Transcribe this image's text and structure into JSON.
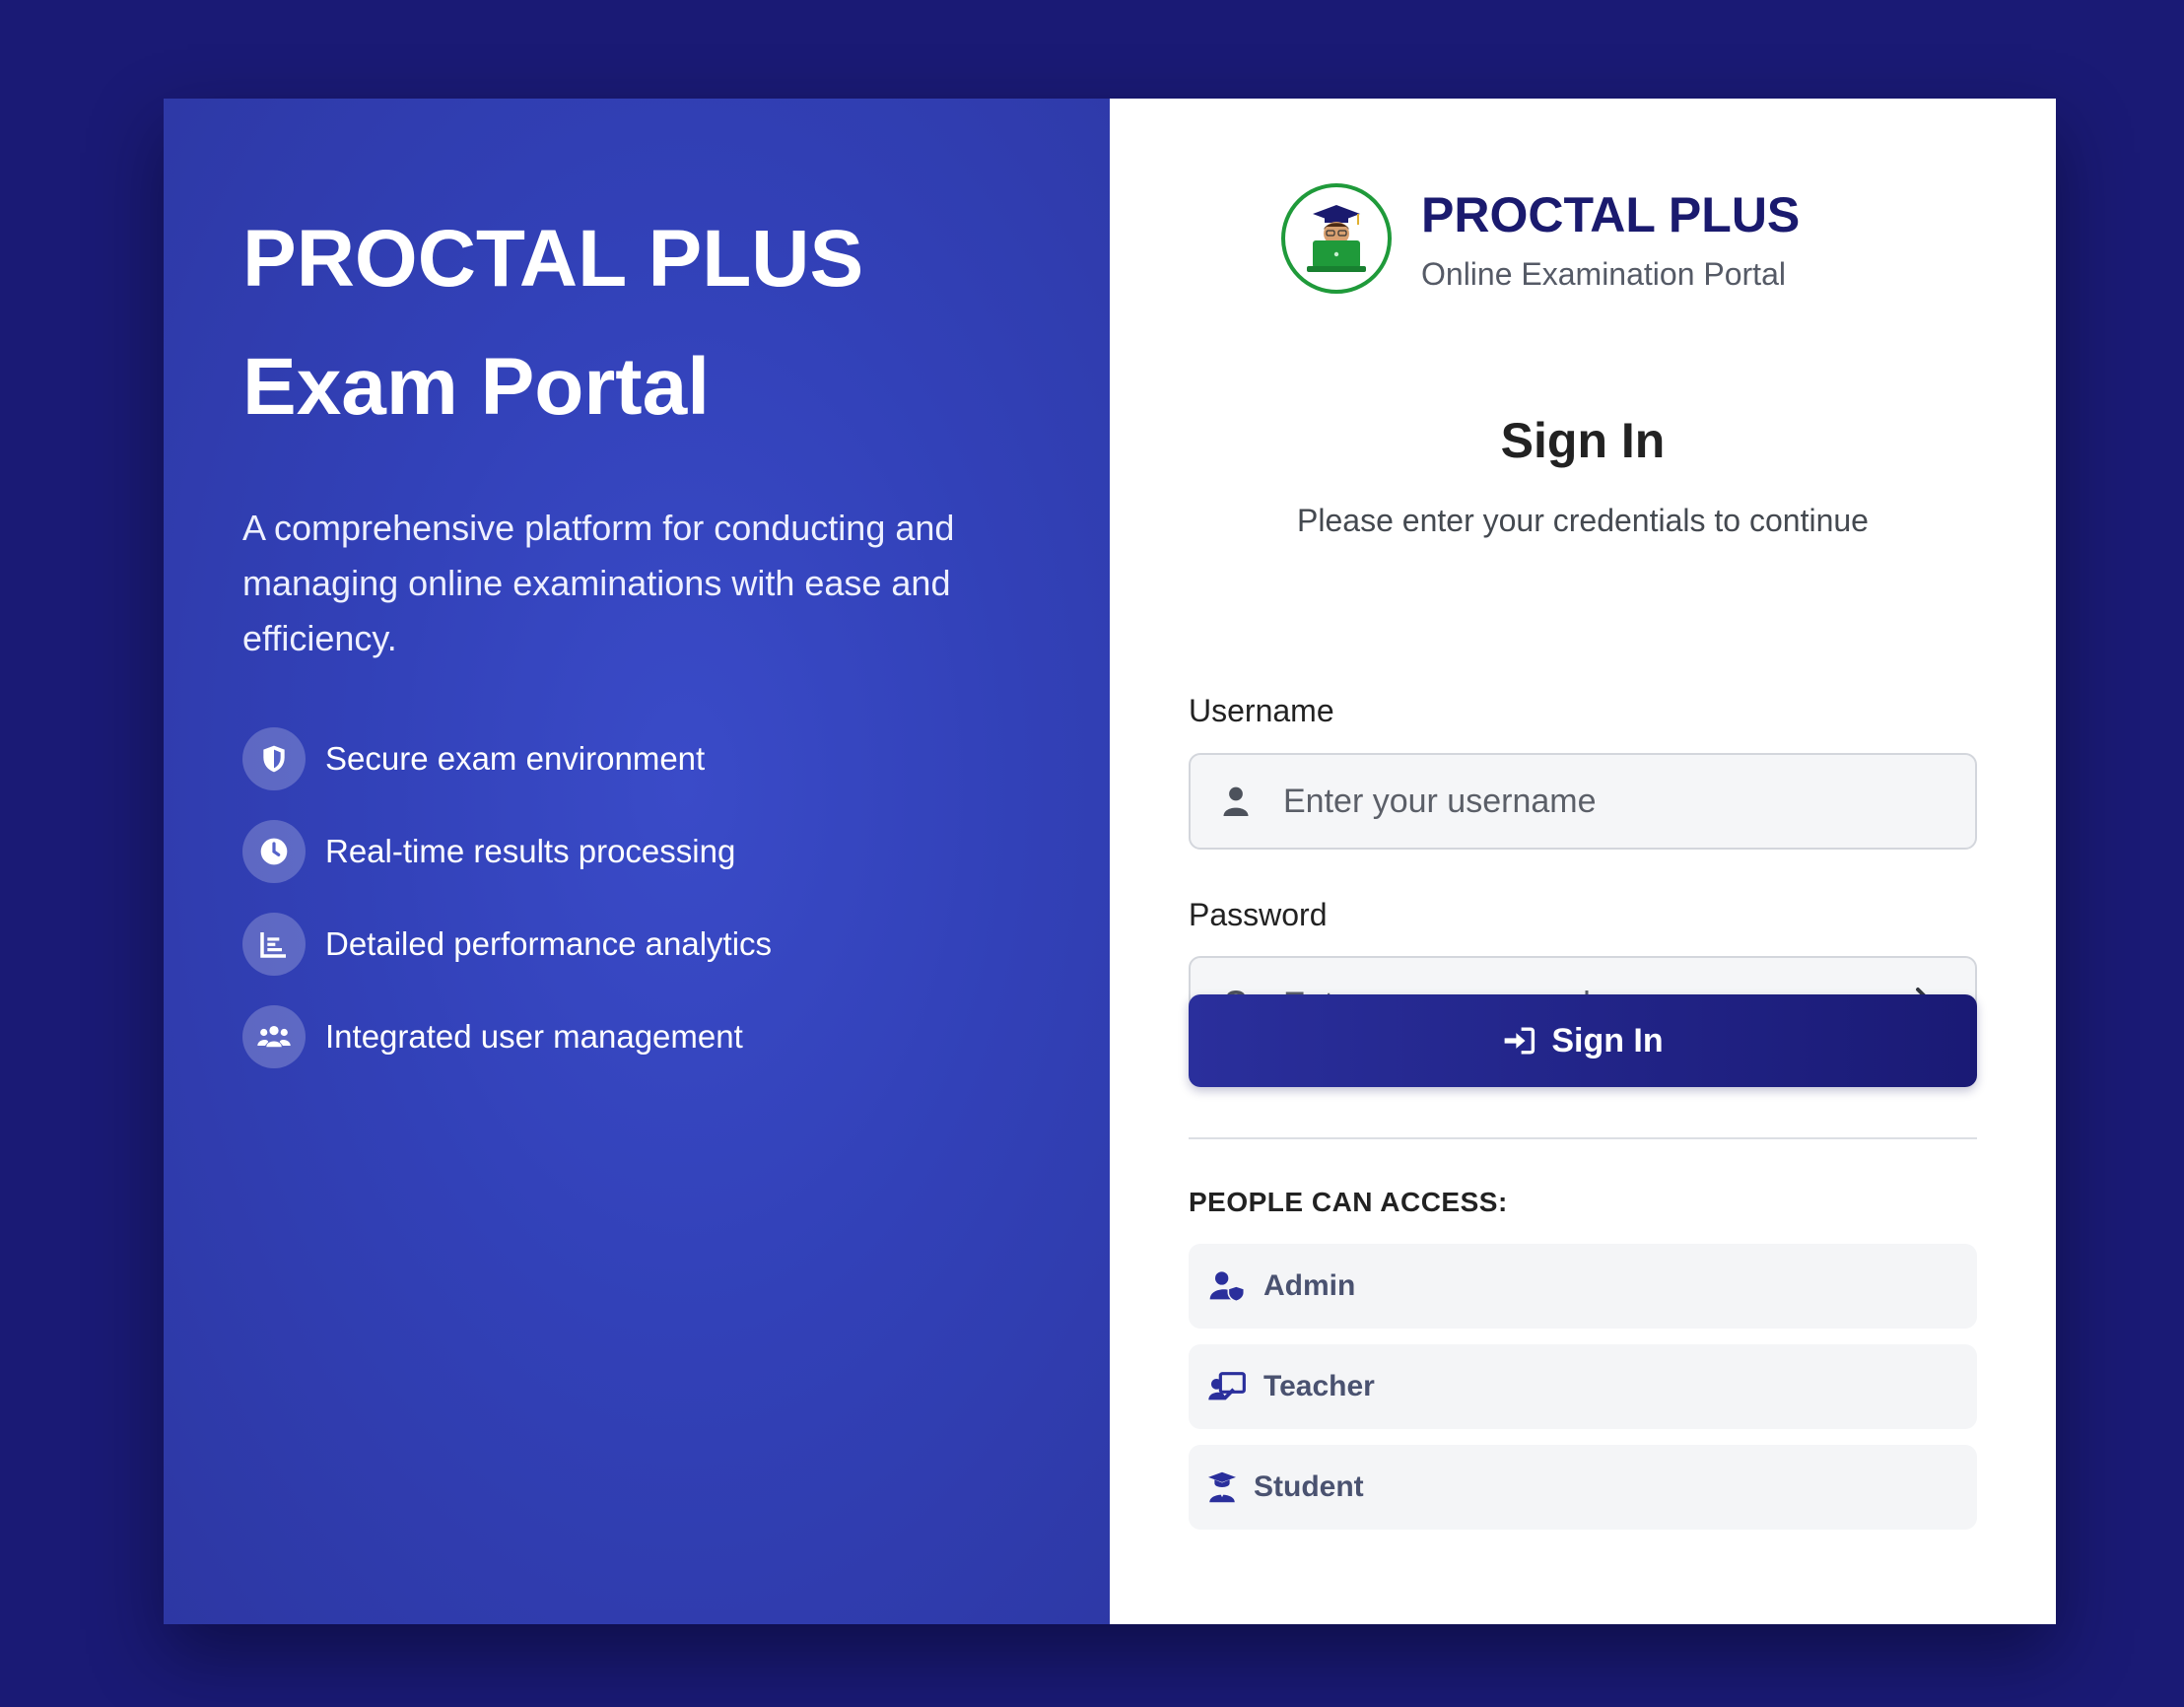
{
  "hero": {
    "title_line1": "PROCTAL PLUS",
    "title_line2": "Exam Portal",
    "description": "A comprehensive platform for conducting and managing online examinations with ease and efficiency.",
    "features": [
      {
        "label": "Secure exam environment",
        "icon": "shield-icon"
      },
      {
        "label": "Real-time results processing",
        "icon": "clock-icon"
      },
      {
        "label": "Detailed performance analytics",
        "icon": "chart-icon"
      },
      {
        "label": "Integrated user management",
        "icon": "users-icon"
      }
    ]
  },
  "brand": {
    "name": "PROCTAL PLUS",
    "subtitle": "Online Examination Portal",
    "logo_icon": "graduate-laptop-logo"
  },
  "form": {
    "title": "Sign In",
    "subtitle": "Please enter your credentials to continue",
    "username_label": "Username",
    "username_placeholder": "Enter your username",
    "username_value": "",
    "password_label": "Password",
    "password_placeholder": "Enter your password",
    "password_value": "",
    "submit_label": "Sign In"
  },
  "access": {
    "title": "PEOPLE CAN ACCESS:",
    "roles": [
      {
        "label": "Admin",
        "icon": "user-shield-icon"
      },
      {
        "label": "Teacher",
        "icon": "chalkboard-teacher-icon"
      },
      {
        "label": "Student",
        "icon": "user-graduate-icon"
      }
    ]
  },
  "colors": {
    "background": "#1a1a75",
    "hero_gradient": "#3a4bc8",
    "brand_text": "#1a1a6e",
    "button": "#2a2f9c",
    "logo_ring": "#1f9a3a",
    "role_icon": "#2a2f9c"
  }
}
